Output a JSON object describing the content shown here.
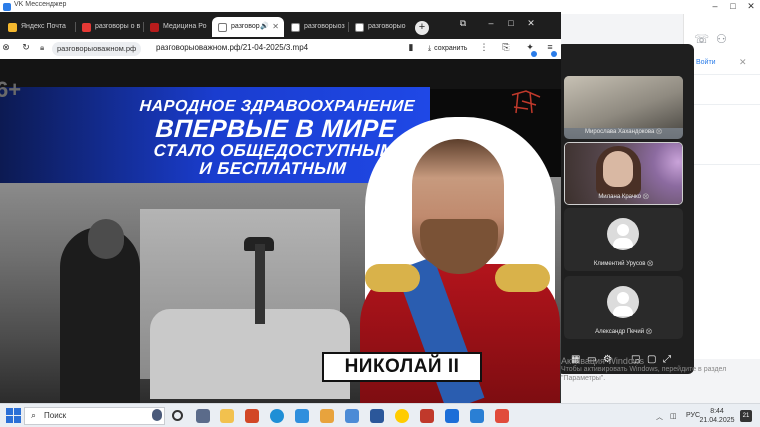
{
  "vk": {
    "window_title": "VK Мессенджер",
    "join_label": "Войти"
  },
  "call": {
    "participants": [
      {
        "name": "Мирослава Хахандокова"
      },
      {
        "name": "Милана Крачко"
      },
      {
        "name": "Климентий Урусов"
      },
      {
        "name": "Александр Печий"
      }
    ],
    "mic_off_glyph": "⨂"
  },
  "browser": {
    "tabs": [
      {
        "label": "Яндекс Почта",
        "favicon_color": "#f5b82e"
      },
      {
        "label": "разговоры о в",
        "favicon_color": "#e53935"
      },
      {
        "label": "Медицина Ро",
        "favicon_color": "#b71c1c"
      },
      {
        "label": "разговор",
        "favicon_color": "#9e9e9e",
        "active": true
      },
      {
        "label": "разговорыоз",
        "favicon_color": "#9e9e9e"
      },
      {
        "label": "разговорыо",
        "favicon_color": "#9e9e9e"
      }
    ],
    "new_tab_glyph": "+",
    "domain_chip": "разговорыоважном.рф",
    "url": "разговорыоважном.рф/21-04-2025/3.mp4",
    "save_label": "сохранить"
  },
  "video": {
    "age_rating": "6+",
    "headline_line1": "НАРОДНОЕ ЗДРАВООХРАНЕНИЕ",
    "headline_line2": "ВПЕРВЫЕ В МИРЕ",
    "headline_line3": "СТАЛО ОБЩЕДОСТУПНЫМ",
    "headline_line4": "И БЕСПЛАТНЫМ",
    "name_plate": "НИКОЛАЙ II"
  },
  "watermark": {
    "title": "Активация Windows",
    "subtitle": "Чтобы активировать Windows, перейдите в раздел \"Параметры\"."
  },
  "taskbar": {
    "search_placeholder": "Поиск",
    "lang": "РУС",
    "time": "8:44",
    "date": "21.04.2025",
    "notification_count": "21"
  }
}
